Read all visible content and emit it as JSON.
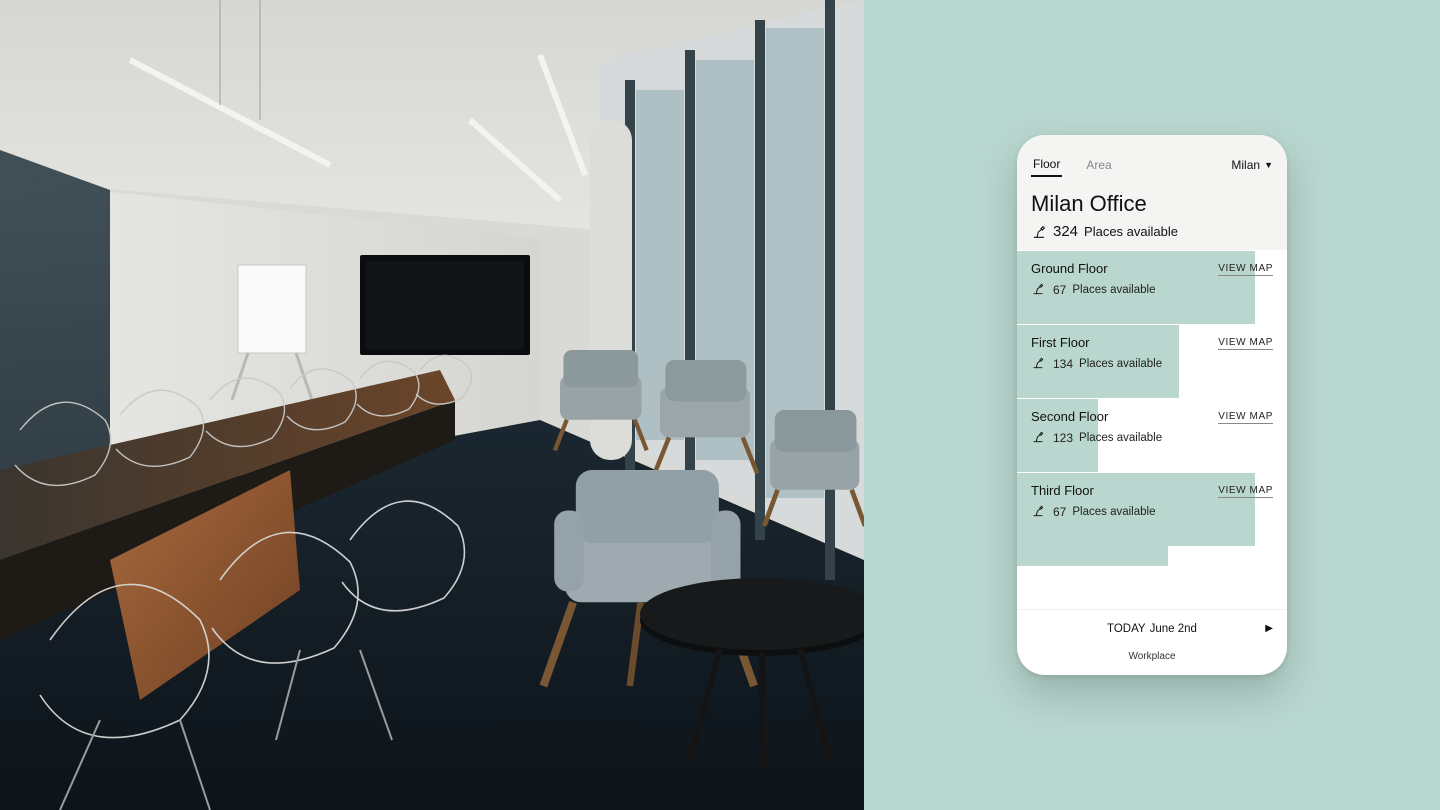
{
  "tabs": {
    "floor": "Floor",
    "area": "Area"
  },
  "city_selector": {
    "label": "Milan"
  },
  "office": {
    "title": "Milan Office",
    "available_count": "324",
    "available_label": "Places available"
  },
  "floors": [
    {
      "name": "Ground Floor",
      "count": "67",
      "label": "Places available",
      "viewmap": "VIEW MAP",
      "fill_pct": 88
    },
    {
      "name": "First Floor",
      "count": "134",
      "label": "Places available",
      "viewmap": "VIEW MAP",
      "fill_pct": 60
    },
    {
      "name": "Second Floor",
      "count": "123",
      "label": "Places available",
      "viewmap": "VIEW MAP",
      "fill_pct": 30
    },
    {
      "name": "Third Floor",
      "count": "67",
      "label": "Places available",
      "viewmap": "VIEW MAP",
      "fill_pct": 88
    }
  ],
  "floor_peek_fill_pct": 56,
  "date_bar": {
    "today": "TODAY",
    "date": "June 2nd"
  },
  "bottom_nav": {
    "workplace": "Workplace"
  },
  "colors": {
    "accent_mint": "#b8d7cf",
    "card_mint": "#b9d7ce"
  }
}
